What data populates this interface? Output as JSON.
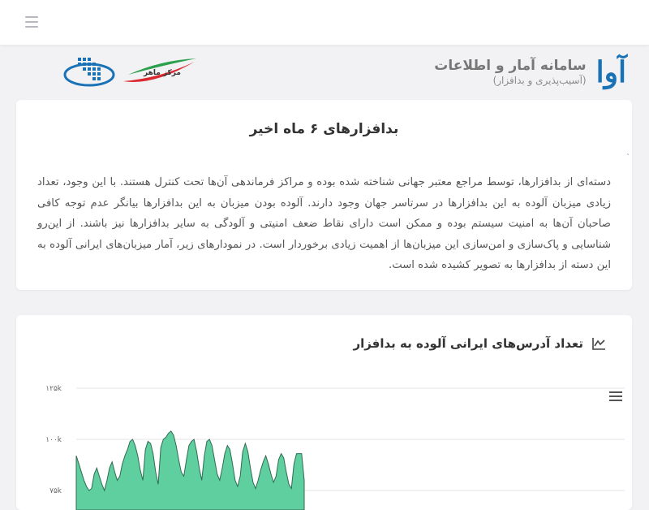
{
  "header": {
    "brand_logo": "آوا",
    "brand_title": "سامانه آمار و اطلاعات",
    "brand_subtitle": "(آسیب‌پذیری و بدافزار)",
    "partner_logo_text": "مرکز ماهر"
  },
  "intro": {
    "title": "بدافزارهای ۶ ماه اخیر",
    "text": "دسته‌ای از بدافزارها، توسط مراجع معتبر جهانی شناخته شده بوده و مراکز فرماندهی آن‌ها تحت کنترل هستند. با این وجود، تعداد زیادی میزبان آلوده به این بدافزارها در سرتاسر جهان وجود دارند. آلوده بودن میزبان به این بدافزارها بیانگر عدم توجه کافی صاحبان آن‌ها به امنیت سیستم بوده و ممکن است دارای نقاط ضعف امنیتی و آلودگی به سایر بدافزارها نیز باشند. از این‌رو شناسایی و پاک‌سازی و امن‌سازی این میزبان‌ها از اهمیت زیادی برخوردار است. در نمودارهای زیر، آمار میزبان‌های ایرانی آلوده به این دسته از بدافزارها به تصویر کشیده شده است.",
    "stray_mark": "`"
  },
  "chart_card": {
    "title": "تعداد آدرس‌های ایرانی آلوده به بدافزار",
    "icon": "area-chart-icon",
    "menu_icon": "hamburger-menu-icon"
  },
  "chart_data": {
    "type": "area",
    "title": "تعداد آدرس‌های ایرانی آلوده به بدافزار",
    "ytick_labels": [
      "۱۲۵k",
      "۱۰۰k",
      "۷۵k"
    ],
    "yticks": [
      125000,
      100000,
      75000
    ],
    "ylim": [
      75000,
      125000
    ],
    "grid": true,
    "color": "#5fcf9f",
    "x": [
      0,
      1,
      2,
      3,
      4,
      5,
      6,
      7,
      8,
      9,
      10,
      11,
      12,
      13,
      14,
      15,
      16,
      17,
      18,
      19,
      20,
      21,
      22,
      23,
      24,
      25,
      26,
      27,
      28,
      29,
      30,
      31,
      32,
      33,
      34,
      35,
      36,
      37,
      38,
      39,
      40,
      41,
      42,
      43,
      44,
      45,
      46,
      47,
      48,
      49,
      50,
      51,
      52,
      53,
      54,
      55,
      56,
      57,
      58,
      59,
      60,
      61,
      62,
      63,
      64,
      65,
      66,
      67,
      68,
      69,
      70,
      71,
      72,
      73,
      74,
      75,
      76,
      77,
      78,
      79,
      80,
      81,
      82,
      83,
      84,
      85,
      86,
      87,
      88,
      89,
      90,
      91,
      92,
      93,
      94,
      95,
      96,
      97,
      98,
      99,
      100,
      101,
      102,
      103,
      104,
      105,
      106,
      107,
      108,
      109,
      110,
      111,
      112,
      113,
      114,
      115,
      116,
      117,
      118,
      119,
      120,
      121,
      122,
      123,
      124,
      125,
      126,
      127,
      128,
      129
    ],
    "values": [
      92000,
      88000,
      84000,
      80000,
      77000,
      75000,
      76000,
      83000,
      86000,
      82000,
      78000,
      75000,
      80000,
      86000,
      89000,
      84000,
      80000,
      82000,
      88000,
      92000,
      95000,
      99000,
      100000,
      97000,
      92000,
      85000,
      80000,
      95000,
      99000,
      98000,
      93000,
      84000,
      78000,
      96000,
      100000,
      101000,
      103000,
      104000,
      102000,
      97000,
      90000,
      84000,
      82000,
      90000,
      97000,
      99000,
      100000,
      94000,
      86000,
      80000,
      92000,
      99000,
      100000,
      97000,
      90000,
      83000,
      80000,
      86000,
      93000,
      97000,
      95000,
      88000,
      80000,
      77000,
      82000,
      94000,
      98000,
      94000,
      86000,
      79000,
      76000,
      80000,
      85000,
      89000,
      92000,
      88000,
      83000,
      79000,
      82000,
      90000,
      93000,
      91000,
      84000,
      78000,
      76000,
      88000,
      93000,
      93000,
      93000,
      80000
    ]
  },
  "topbar": {
    "menu_icon": "hamburger-icon"
  },
  "colors": {
    "brand_blue": "#1a72b6",
    "accent_red": "#d9282f",
    "accent_green": "#2ca04c",
    "series": "#5fcf9f"
  }
}
